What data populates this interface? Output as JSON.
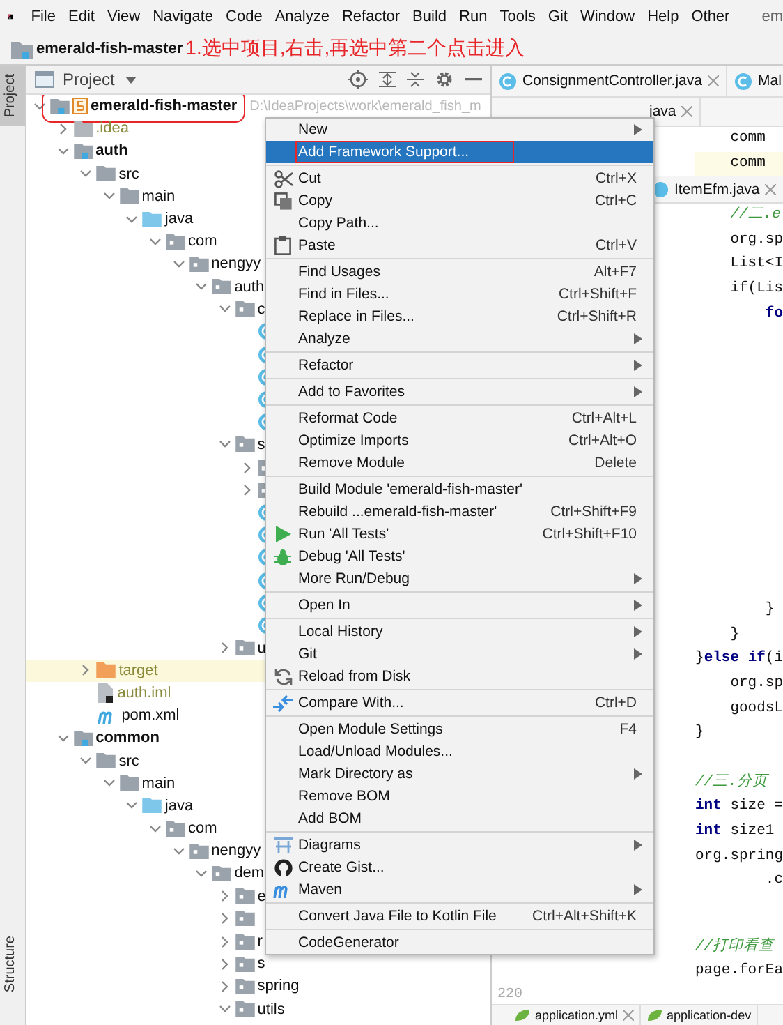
{
  "menu_bar": {
    "items": [
      "File",
      "Edit",
      "View",
      "Navigate",
      "Code",
      "Analyze",
      "Refactor",
      "Build",
      "Run",
      "Tools",
      "Git",
      "Window",
      "Help",
      "Other"
    ],
    "title": "em"
  },
  "breadcrumb": {
    "project": "emerald-fish-master",
    "annotation": "1.选中项目,右击,再选中第二个点击进入"
  },
  "tool_strip": {
    "top": {
      "label": "Project",
      "selected": true
    },
    "bottom": {
      "label": "Structure",
      "selected": false
    }
  },
  "project_panel": {
    "title": "Project",
    "tree": [
      {
        "label": "emerald-fish-master",
        "kind": "project",
        "path": "D:\\IdeaProjects\\work\\emerald_fish_m",
        "expanded": true,
        "boxed": true,
        "children": [
          {
            "label": ".idea",
            "kind": "excluded",
            "expanded": false
          },
          {
            "label": "auth",
            "kind": "module",
            "expanded": true,
            "children": [
              {
                "label": "src",
                "kind": "folder",
                "expanded": true,
                "children": [
                  {
                    "label": "main",
                    "kind": "folder",
                    "expanded": true,
                    "children": [
                      {
                        "label": "java",
                        "kind": "source",
                        "expanded": true,
                        "children": [
                          {
                            "label": "com",
                            "kind": "package",
                            "expanded": true,
                            "children": [
                              {
                                "label": "nengyy",
                                "kind": "package",
                                "expanded": true,
                                "children": [
                                  {
                                    "label": "auth",
                                    "kind": "package",
                                    "expanded": true,
                                    "children": [
                                      {
                                        "label": "c",
                                        "kind": "package",
                                        "expanded": true,
                                        "children": [
                                          {
                                            "kind": "class"
                                          },
                                          {
                                            "kind": "class"
                                          },
                                          {
                                            "kind": "class"
                                          },
                                          {
                                            "kind": "class"
                                          },
                                          {
                                            "kind": "class"
                                          }
                                        ]
                                      },
                                      {
                                        "label": "s",
                                        "kind": "package",
                                        "expanded": true,
                                        "children": [
                                          {
                                            "kind": "package",
                                            "expanded": false
                                          },
                                          {
                                            "kind": "package",
                                            "expanded": false
                                          },
                                          {
                                            "kind": "class"
                                          },
                                          {
                                            "kind": "class"
                                          },
                                          {
                                            "kind": "class"
                                          },
                                          {
                                            "kind": "class"
                                          },
                                          {
                                            "kind": "class"
                                          },
                                          {
                                            "kind": "class"
                                          }
                                        ]
                                      },
                                      {
                                        "label": "u",
                                        "kind": "package",
                                        "expanded": false
                                      }
                                    ]
                                  }
                                ]
                              }
                            ]
                          }
                        ]
                      }
                    ]
                  }
                ]
              },
              {
                "label": "target",
                "kind": "target",
                "expanded": false
              },
              {
                "label": "auth.iml",
                "kind": "iml"
              },
              {
                "label": "pom.xml",
                "kind": "pom"
              }
            ]
          },
          {
            "label": "common",
            "kind": "module",
            "expanded": true,
            "children": [
              {
                "label": "src",
                "kind": "folder",
                "expanded": true,
                "children": [
                  {
                    "label": "main",
                    "kind": "folder",
                    "expanded": true,
                    "children": [
                      {
                        "label": "java",
                        "kind": "source",
                        "expanded": true,
                        "children": [
                          {
                            "label": "com",
                            "kind": "package",
                            "expanded": true,
                            "children": [
                              {
                                "label": "nengyy",
                                "kind": "package",
                                "expanded": true,
                                "children": [
                                  {
                                    "label": "dem",
                                    "kind": "package",
                                    "expanded": true,
                                    "children": [
                                      {
                                        "label": "e",
                                        "kind": "package",
                                        "expanded": false
                                      },
                                      {
                                        "kind": "package",
                                        "expanded": false
                                      },
                                      {
                                        "label": "r",
                                        "kind": "package",
                                        "expanded": false
                                      },
                                      {
                                        "label": "s",
                                        "kind": "package",
                                        "expanded": false
                                      },
                                      {
                                        "label": "spring",
                                        "kind": "package",
                                        "expanded": false
                                      },
                                      {
                                        "label": "utils",
                                        "kind": "package",
                                        "expanded": true
                                      }
                                    ]
                                  }
                                ]
                              }
                            ]
                          }
                        ]
                      }
                    ]
                  }
                ]
              }
            ]
          }
        ]
      }
    ]
  },
  "editor": {
    "tabs": [
      {
        "label": "ConsignmentController.java",
        "closable": true
      },
      {
        "label": "Mal",
        "closable": false
      }
    ],
    "tabs_2": [
      {
        "label": "java",
        "closable": true
      }
    ],
    "tabs_3": [
      {
        "label": "ItemEfm.java",
        "closable": true
      }
    ],
    "code_blocks": [
      [
        {
          "kind": "code",
          "text": "    comm"
        },
        {
          "kind": "code",
          "text": "    comm"
        }
      ],
      [
        {
          "kind": "comment",
          "text": "    //二.e"
        },
        {
          "kind": "code",
          "text": "    org.sp"
        },
        {
          "kind": "code",
          "text": "    List<I"
        },
        {
          "kind": "code",
          "text": "    if(Lis"
        },
        {
          "kind": "code",
          "text": "        **fo**"
        }
      ],
      [
        {
          "kind": "code",
          "text": "        }"
        },
        {
          "kind": "code",
          "text": "    }"
        },
        {
          "kind": "code",
          "text": "}**else if**(i"
        },
        {
          "kind": "code",
          "text": "    org.sp"
        },
        {
          "kind": "code",
          "text": "    goodsL"
        },
        {
          "kind": "code",
          "text": "}"
        }
      ],
      [
        {
          "kind": "comment",
          "text": "//三.分页"
        },
        {
          "kind": "code",
          "text": "**int** size ="
        },
        {
          "kind": "code",
          "text": "**int** size1"
        },
        {
          "kind": "code",
          "text": "org.spring"
        },
        {
          "kind": "code",
          "text": "        .c"
        }
      ],
      [
        {
          "kind": "comment",
          "text": "//打印看查"
        },
        {
          "kind": "code",
          "text": "page.forEa"
        }
      ]
    ],
    "line_number": "220",
    "bottom_tabs": [
      {
        "label": "application.yml",
        "closable": true
      },
      {
        "label": "application-dev",
        "closable": false
      }
    ]
  },
  "context_menu": {
    "groups": [
      [
        {
          "label": "New",
          "kind": "plain",
          "submenu": true,
          "selected": false
        },
        {
          "label": "Add Framework Support...",
          "kind": "plain",
          "submenu": false,
          "selected": true,
          "boxed": true
        }
      ],
      [
        {
          "label": "Cut",
          "kind": "cut",
          "shortcut": "Ctrl+X",
          "submenu": false,
          "selected": false
        },
        {
          "label": "Copy",
          "kind": "copy",
          "shortcut": "Ctrl+C",
          "submenu": false,
          "selected": false
        },
        {
          "label": "Copy Path...",
          "kind": "plain",
          "submenu": false,
          "selected": false
        },
        {
          "label": "Paste",
          "kind": "paste",
          "shortcut": "Ctrl+V",
          "submenu": false,
          "selected": false
        }
      ],
      [
        {
          "label": "Find Usages",
          "kind": "plain",
          "shortcut": "Alt+F7",
          "submenu": false,
          "selected": false
        },
        {
          "label": "Find in Files...",
          "kind": "plain",
          "shortcut": "Ctrl+Shift+F",
          "submenu": false,
          "selected": false
        },
        {
          "label": "Replace in Files...",
          "kind": "plain",
          "shortcut": "Ctrl+Shift+R",
          "submenu": false,
          "selected": false
        },
        {
          "label": "Analyze",
          "kind": "plain",
          "submenu": true,
          "selected": false
        }
      ],
      [
        {
          "label": "Refactor",
          "kind": "plain",
          "submenu": true,
          "selected": false
        }
      ],
      [
        {
          "label": "Add to Favorites",
          "kind": "plain",
          "submenu": true,
          "selected": false
        }
      ],
      [
        {
          "label": "Reformat Code",
          "kind": "plain",
          "shortcut": "Ctrl+Alt+L",
          "submenu": false,
          "selected": false
        },
        {
          "label": "Optimize Imports",
          "kind": "plain",
          "shortcut": "Ctrl+Alt+O",
          "submenu": false,
          "selected": false
        },
        {
          "label": "Remove Module",
          "kind": "plain",
          "shortcut": "Delete",
          "submenu": false,
          "selected": false
        }
      ],
      [
        {
          "label": "Build Module 'emerald-fish-master'",
          "kind": "plain",
          "submenu": false,
          "selected": false
        },
        {
          "label": "Rebuild ...emerald-fish-master'",
          "kind": "plain",
          "shortcut": "Ctrl+Shift+F9",
          "submenu": false,
          "selected": false
        },
        {
          "label": "Run 'All Tests'",
          "kind": "run",
          "shortcut": "Ctrl+Shift+F10",
          "submenu": false,
          "selected": false
        },
        {
          "label": "Debug 'All Tests'",
          "kind": "debug",
          "submenu": false,
          "selected": false
        },
        {
          "label": "More Run/Debug",
          "kind": "plain",
          "submenu": true,
          "selected": false
        }
      ],
      [
        {
          "label": "Open In",
          "kind": "plain",
          "submenu": true,
          "selected": false
        }
      ],
      [
        {
          "label": "Local History",
          "kind": "plain",
          "submenu": true,
          "selected": false
        },
        {
          "label": "Git",
          "kind": "plain",
          "submenu": true,
          "selected": false
        },
        {
          "label": "Reload from Disk",
          "kind": "reload",
          "submenu": false,
          "selected": false
        }
      ],
      [
        {
          "label": "Compare With...",
          "kind": "compare",
          "shortcut": "Ctrl+D",
          "submenu": false,
          "selected": false
        }
      ],
      [
        {
          "label": "Open Module Settings",
          "kind": "plain",
          "shortcut": "F4",
          "submenu": false,
          "selected": false
        },
        {
          "label": "Load/Unload Modules...",
          "kind": "plain",
          "submenu": false,
          "selected": false
        },
        {
          "label": "Mark Directory as",
          "kind": "plain",
          "submenu": true,
          "selected": false
        },
        {
          "label": "Remove BOM",
          "kind": "plain",
          "submenu": false,
          "selected": false
        },
        {
          "label": "Add BOM",
          "kind": "plain",
          "submenu": false,
          "selected": false
        }
      ],
      [
        {
          "label": "Diagrams",
          "kind": "diagrams",
          "submenu": true,
          "selected": false
        },
        {
          "label": "Create Gist...",
          "kind": "gist",
          "submenu": false,
          "selected": false
        },
        {
          "label": "Maven",
          "kind": "maven",
          "submenu": true,
          "selected": false
        }
      ],
      [
        {
          "label": "Convert Java File to Kotlin File",
          "kind": "plain",
          "shortcut": "Ctrl+Alt+Shift+K",
          "submenu": false,
          "selected": false
        }
      ],
      [
        {
          "label": "CodeGenerator",
          "kind": "plain",
          "submenu": false,
          "selected": false
        }
      ]
    ]
  }
}
